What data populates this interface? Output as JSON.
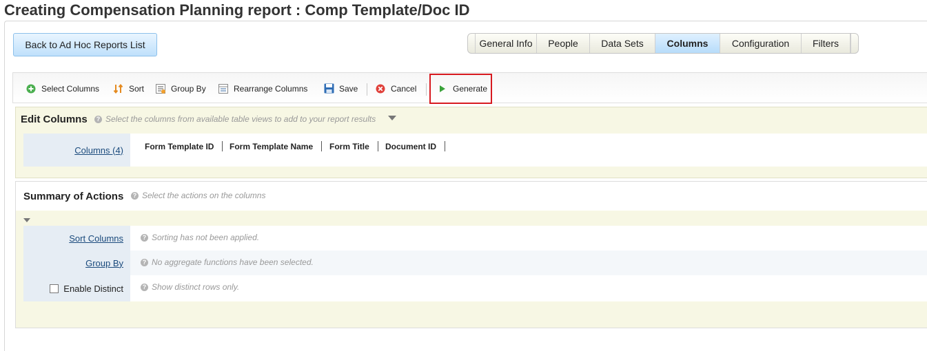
{
  "page": {
    "title": "Creating Compensation Planning report : Comp Template/Doc ID"
  },
  "back_button": {
    "label": "Back to Ad Hoc Reports List"
  },
  "tabs": [
    {
      "label": "General Info",
      "active": false
    },
    {
      "label": "People",
      "active": false
    },
    {
      "label": "Data Sets",
      "active": false
    },
    {
      "label": "Columns",
      "active": true
    },
    {
      "label": "Configuration",
      "active": false
    },
    {
      "label": "Filters",
      "active": false
    }
  ],
  "toolbar": {
    "select_columns": "Select Columns",
    "sort": "Sort",
    "group_by": "Group By",
    "rearrange_columns": "Rearrange Columns",
    "save": "Save",
    "cancel": "Cancel",
    "generate": "Generate",
    "highlight_color": "#d7191f"
  },
  "edit_columns": {
    "title": "Edit Columns",
    "help": "Select the columns from available table views to add to your report results",
    "columns_link": "Columns (4)",
    "columns": [
      "Form Template ID",
      "Form Template Name",
      "Form Title",
      "Document ID"
    ]
  },
  "summary": {
    "title": "Summary of Actions",
    "help": "Select the actions on the columns",
    "sort_columns": {
      "label": "Sort Columns",
      "help": "Sorting has not been applied."
    },
    "group_by": {
      "label": "Group By",
      "help": "No aggregate functions have been selected."
    },
    "enable_distinct": {
      "label": "Enable Distinct",
      "checked": false,
      "help": "Show distinct rows only."
    }
  }
}
